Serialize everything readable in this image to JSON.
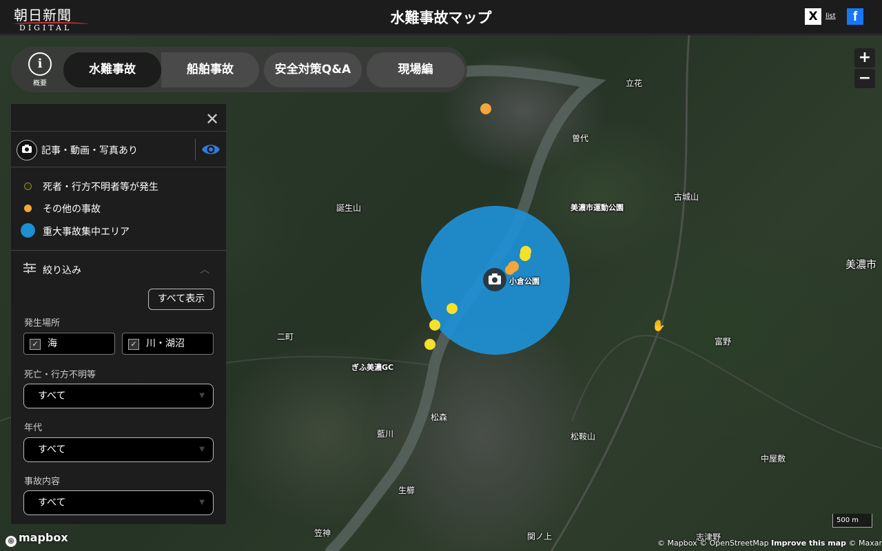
{
  "header": {
    "logo_jp": "朝日新聞",
    "logo_en": "DIGITAL",
    "title": "水難事故マップ",
    "x_label": "X",
    "list_label": "list",
    "facebook_label": "f"
  },
  "tabs": {
    "info_icon": "i",
    "info_label": "概要",
    "items": [
      "水難事故",
      "船舶事故",
      "安全対策Q&A",
      "現場編"
    ],
    "active": "水難事故"
  },
  "panel": {
    "close_icon": "close-icon",
    "photo_toggle_label": "記事・動画・写真あり",
    "legend": [
      {
        "label": "死者・行方不明者等が発生",
        "color": "#3a3a1a"
      },
      {
        "label": "その他の事故",
        "color": "#f5a63a"
      },
      {
        "label": "重大事故集中エリア",
        "color": "#1e8fd0"
      }
    ],
    "filter_title": "絞り込み",
    "show_all_button": "すべて表示",
    "location_label": "発生場所",
    "location_options": [
      {
        "label": "海",
        "checked": true
      },
      {
        "label": "川・湖沼",
        "checked": true
      }
    ],
    "death_label": "死亡・行方不明等",
    "death_value": "すべて",
    "era_label": "年代",
    "era_value": "すべて",
    "content_label": "事故内容",
    "content_value": "すべて"
  },
  "map": {
    "places": [
      "立花",
      "曽代",
      "古城山",
      "美濃市運動公園",
      "誕生山",
      "美濃市",
      "小倉公園",
      "二町",
      "富野",
      "ぎふ美濃GC",
      "松森",
      "藍川",
      "松鞍山",
      "中屋敷",
      "生櫛",
      "笠神",
      "関ノ上",
      "志津野"
    ],
    "zoom_in": "+",
    "zoom_out": "−",
    "scale": "500 m",
    "attribution": "© Mapbox © OpenStreetMap",
    "improve": "Improve this map",
    "attribution_tail": "© Maxar",
    "mapbox_logo": "mapbox",
    "photo_marker_icon": "camera-icon",
    "colors": {
      "cluster": "#1e90d6",
      "other_accident": "#f5a63a",
      "minor": "#f5e02a"
    }
  }
}
